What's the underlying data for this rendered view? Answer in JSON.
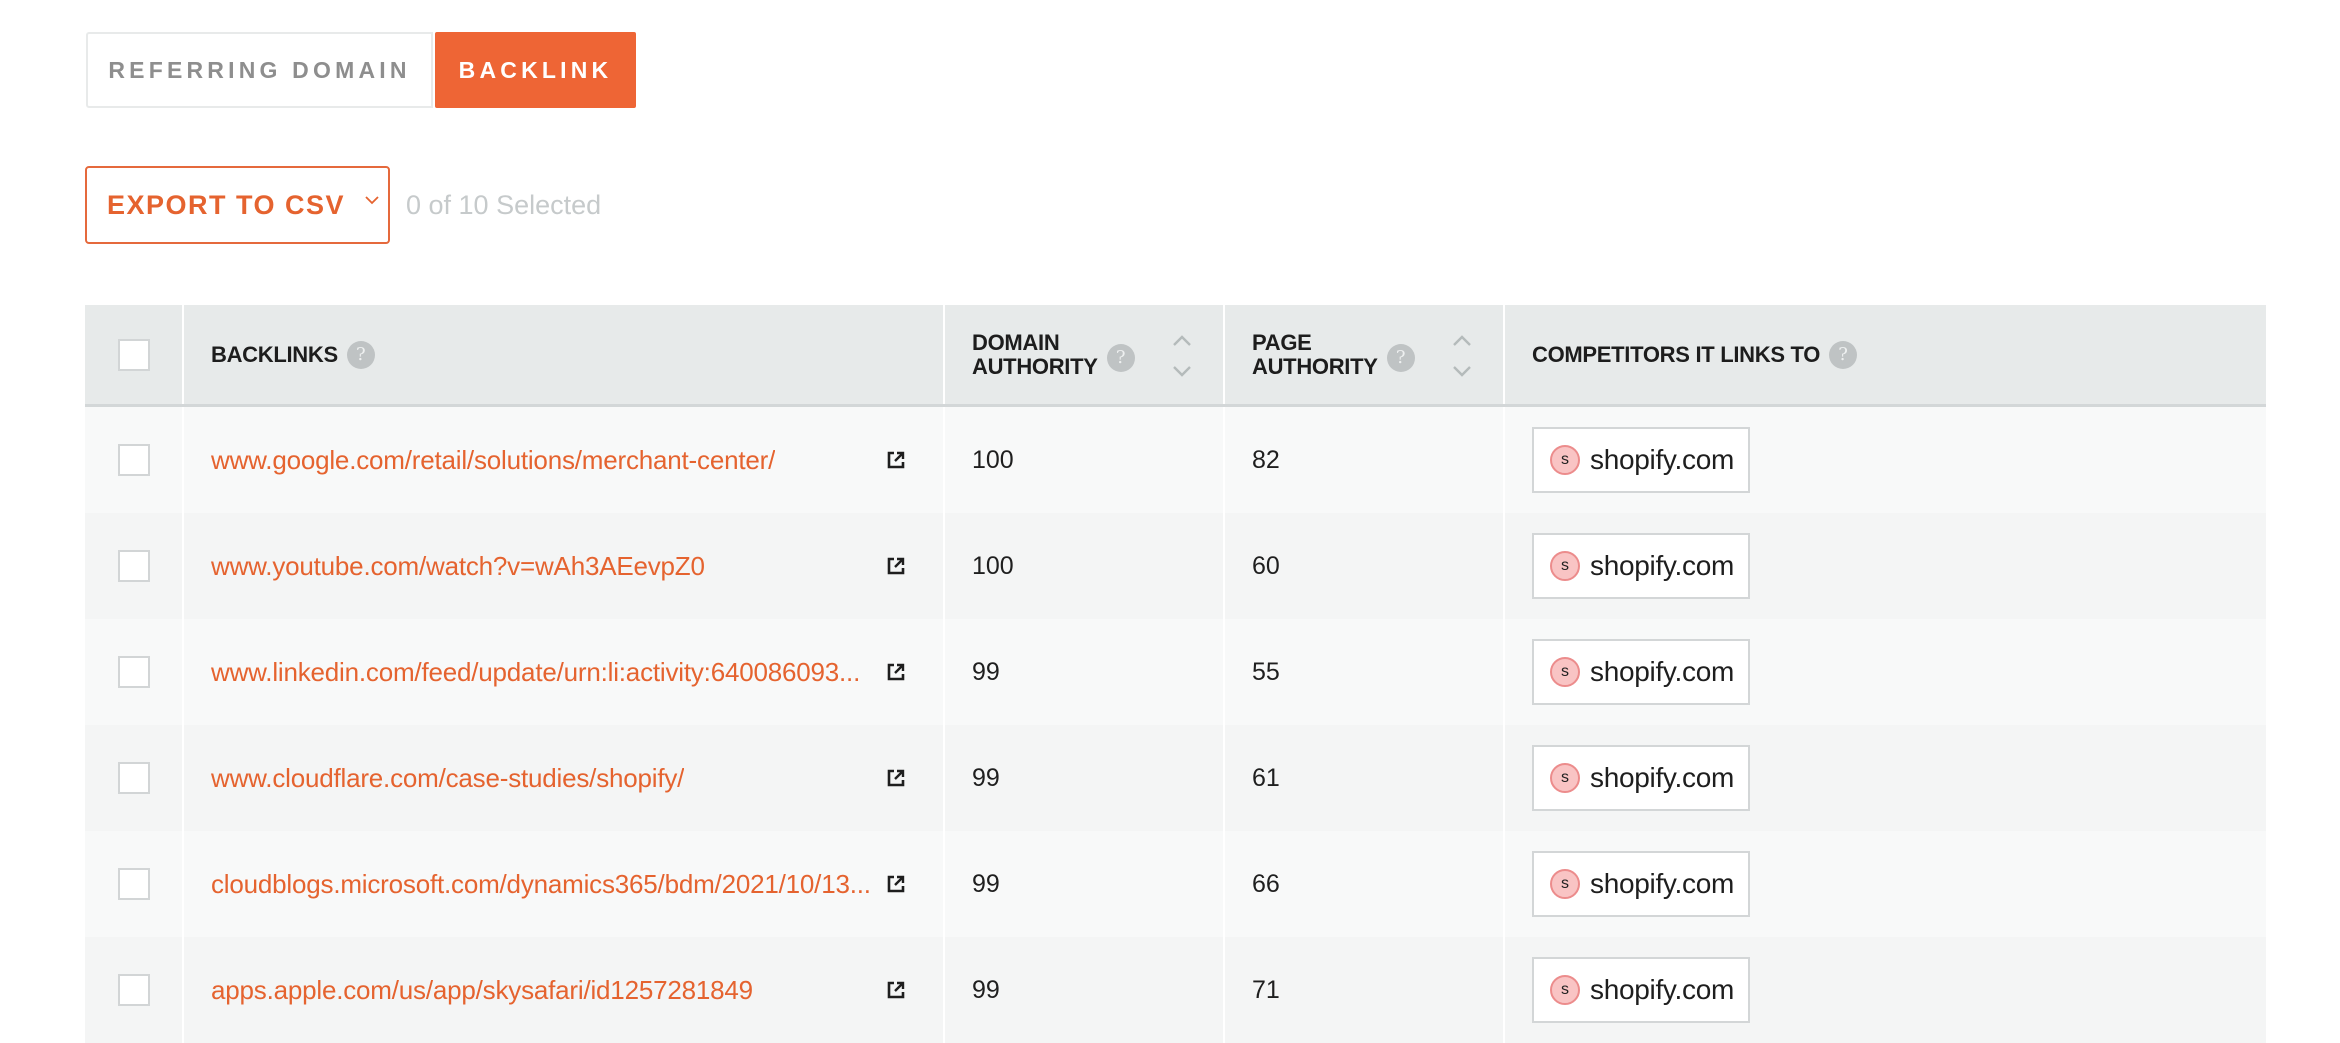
{
  "tabs": [
    {
      "label": "REFERRING DOMAIN",
      "active": false
    },
    {
      "label": "BACKLINK",
      "active": true
    }
  ],
  "toolbar": {
    "export_label": "EXPORT TO CSV",
    "export_icon": "chevron-down-icon",
    "selection_status": "0 of 10 Selected"
  },
  "colors": {
    "accent": "#ee6535",
    "link": "#e5632f",
    "header_bg": "#e7eaea"
  },
  "table": {
    "columns": [
      {
        "label": "",
        "type": "select-all-checkbox"
      },
      {
        "label": "BACKLINKS",
        "help": "?"
      },
      {
        "label_line1": "DOMAIN",
        "label_line2": "AUTHORITY",
        "help": "?",
        "sortable": true
      },
      {
        "label_line1": "PAGE",
        "label_line2": "AUTHORITY",
        "help": "?",
        "sortable": true
      },
      {
        "label": "COMPETITORS IT LINKS TO",
        "help": "?"
      }
    ],
    "rows": [
      {
        "backlink": "www.google.com/retail/solutions/merchant-center/",
        "domain_authority": "100",
        "page_authority": "82",
        "competitor": {
          "initial": "s",
          "domain": "shopify.com"
        }
      },
      {
        "backlink": "www.youtube.com/watch?v=wAh3AEevpZ0",
        "domain_authority": "100",
        "page_authority": "60",
        "competitor": {
          "initial": "s",
          "domain": "shopify.com"
        }
      },
      {
        "backlink": "www.linkedin.com/feed/update/urn:li:activity:640086093...",
        "domain_authority": "99",
        "page_authority": "55",
        "competitor": {
          "initial": "s",
          "domain": "shopify.com"
        }
      },
      {
        "backlink": "www.cloudflare.com/case-studies/shopify/",
        "domain_authority": "99",
        "page_authority": "61",
        "competitor": {
          "initial": "s",
          "domain": "shopify.com"
        }
      },
      {
        "backlink": "cloudblogs.microsoft.com/dynamics365/bdm/2021/10/13...",
        "domain_authority": "99",
        "page_authority": "66",
        "competitor": {
          "initial": "s",
          "domain": "shopify.com"
        }
      },
      {
        "backlink": "apps.apple.com/us/app/skysafari/id1257281849",
        "domain_authority": "99",
        "page_authority": "71",
        "competitor": {
          "initial": "s",
          "domain": "shopify.com"
        }
      }
    ]
  }
}
